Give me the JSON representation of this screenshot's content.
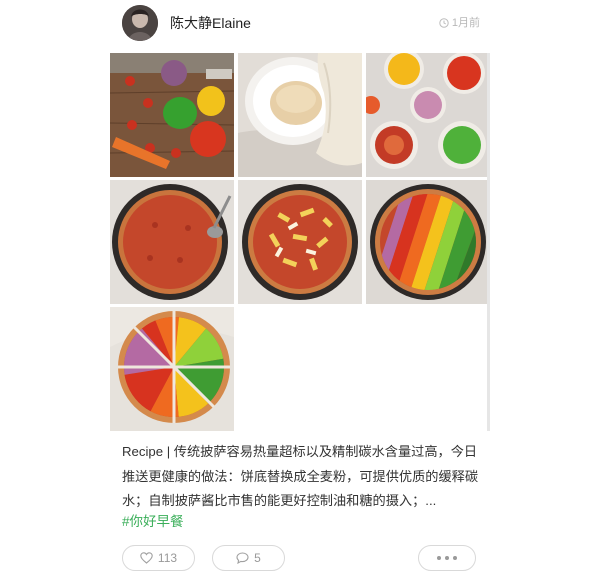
{
  "post": {
    "author": {
      "name": "陈大静Elaine"
    },
    "timestamp": "1月前",
    "images": [
      {
        "label": "vegetables-on-board"
      },
      {
        "label": "dough-in-bowl"
      },
      {
        "label": "chopped-toppings-bowls"
      },
      {
        "label": "tomato-sauce-base"
      },
      {
        "label": "cheese-layer"
      },
      {
        "label": "rainbow-vegetable-pizza"
      },
      {
        "label": "sliced-pizza"
      }
    ],
    "text": "Recipe | 传统披萨容易热量超标以及精制碳水含量过高，今日推送更健康的做法：饼底替换成全麦粉，可提供优质的缓释碳水；自制披萨酱比市售的能更好控制油和糖的摄入；...",
    "hashtag": "#你好早餐",
    "actions": {
      "likes": "113",
      "comments": "5"
    }
  },
  "colors": {
    "hashtag": "#3aae59",
    "muted": "#999999",
    "border": "#d9d9d9"
  },
  "icons": {
    "time": "clock-icon",
    "like": "heart-icon",
    "comment": "comment-bubble-icon",
    "more": "more-dots-icon"
  }
}
